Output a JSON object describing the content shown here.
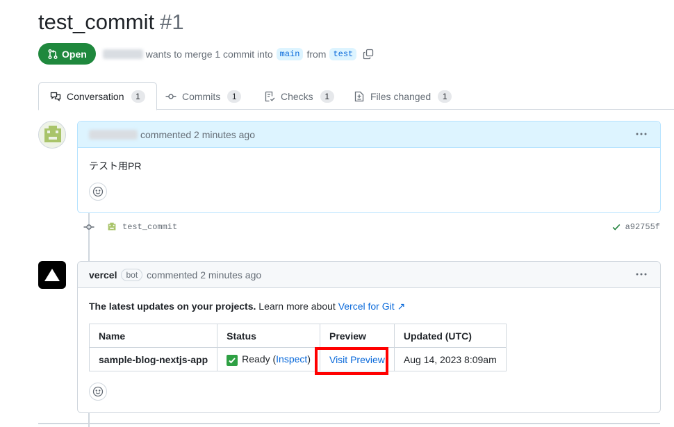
{
  "pr": {
    "title": "test_commit",
    "number": "#1",
    "state": "Open",
    "meta_text": "wants to merge 1 commit into",
    "from_text": "from",
    "base_branch": "main",
    "head_branch": "test"
  },
  "tabs": [
    {
      "label": "Conversation",
      "count": "1"
    },
    {
      "label": "Commits",
      "count": "1"
    },
    {
      "label": "Checks",
      "count": "1"
    },
    {
      "label": "Files changed",
      "count": "1"
    }
  ],
  "comment1": {
    "action": "commented 2 minutes ago",
    "body": "テスト用PR"
  },
  "commit": {
    "message": "test_commit",
    "sha": "a92755f"
  },
  "comment2": {
    "author": "vercel",
    "badge": "bot",
    "action": "commented 2 minutes ago",
    "intro_bold": "The latest updates on your projects.",
    "intro_text": "Learn more about",
    "intro_link": "Vercel for Git ↗",
    "table": {
      "headers": [
        "Name",
        "Status",
        "Preview",
        "Updated (UTC)"
      ],
      "row": {
        "name": "sample-blog-nextjs-app",
        "status": "Ready",
        "inspect_open": "(",
        "inspect": "Inspect",
        "inspect_close": ")",
        "preview": "Visit Preview",
        "updated": "Aug 14, 2023 8:09am"
      }
    }
  },
  "colors": {
    "open_green": "#1f883d",
    "link_blue": "#0969da",
    "highlight_red": "#ff0000"
  }
}
